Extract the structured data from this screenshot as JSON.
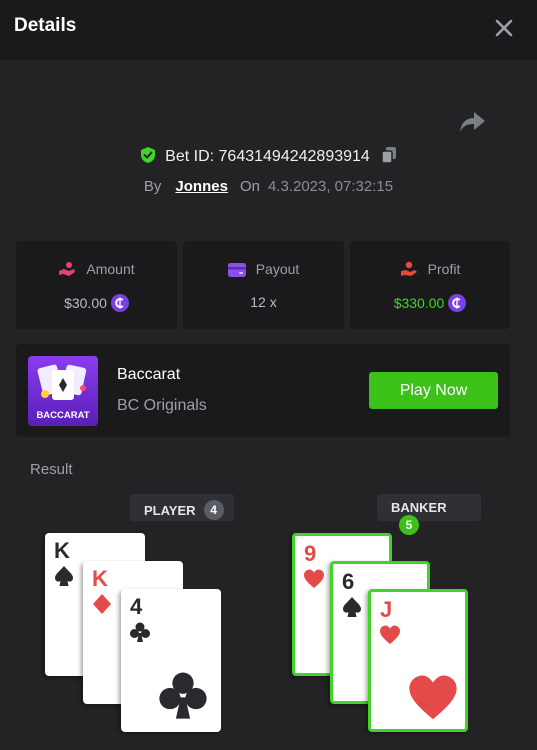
{
  "header": {
    "title": "Details",
    "close_icon": "close-icon"
  },
  "share_icon": "share-icon",
  "bet": {
    "label": "Bet ID:",
    "id": "76431494242893914",
    "shield_icon": "shield-check-icon",
    "copy_icon": "copy-icon"
  },
  "byline": {
    "by": "By",
    "user": "Jonnes",
    "on": "On",
    "date": "4.3.2023, 07:32:15"
  },
  "stats": {
    "amount": {
      "label": "Amount",
      "value": "$30.00",
      "icon": "hand-coins-icon"
    },
    "payout": {
      "label": "Payout",
      "value": "12 x",
      "icon": "wallet-icon"
    },
    "profit": {
      "label": "Profit",
      "value": "$330.00",
      "icon": "profit-hand-icon"
    }
  },
  "game": {
    "name": "Baccarat",
    "provider": "BC Originals",
    "thumb_text": "BACCARAT",
    "play_label": "Play Now"
  },
  "result": {
    "label": "Result",
    "player": {
      "label": "PLAYER",
      "score": "4",
      "cards": [
        {
          "rank": "K",
          "suit": "spade"
        },
        {
          "rank": "K",
          "suit": "diamond"
        },
        {
          "rank": "4",
          "suit": "club"
        }
      ]
    },
    "banker": {
      "label": "BANKER",
      "score": "5",
      "cards": [
        {
          "rank": "9",
          "suit": "heart"
        },
        {
          "rank": "6",
          "suit": "spade"
        },
        {
          "rank": "J",
          "suit": "heart"
        }
      ]
    }
  },
  "colors": {
    "accent_green": "#3bc117",
    "profit_green": "#3fd427",
    "coin_purple": "#7b3fe4",
    "bg": "#232326",
    "panel": "#1a1a1c"
  }
}
